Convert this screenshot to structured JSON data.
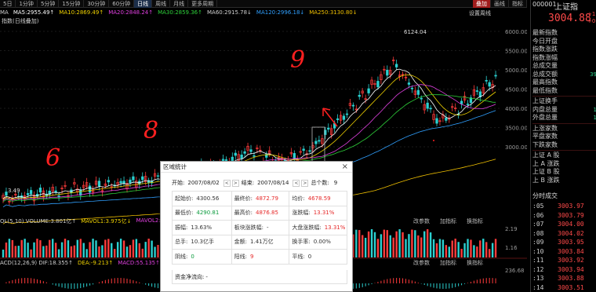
{
  "tabs": [
    "5日",
    "1分钟",
    "5分钟",
    "15分钟",
    "30分钟",
    "60分钟",
    "日线",
    "周线",
    "月线",
    "更多周期"
  ],
  "tabs_right": [
    "叠加",
    "画线",
    "指标"
  ],
  "chart_title": "指数(日线叠加)",
  "settings_label": "设置周线",
  "ma": [
    {
      "label": "MA",
      "color": "#cfcfcf"
    },
    {
      "label": "MA5:2955.49↑",
      "color": "#ffffff"
    },
    {
      "label": "MA10:2869.49↑",
      "color": "#f0d200"
    },
    {
      "label": "MA20:2848.24↑",
      "color": "#e040e0"
    },
    {
      "label": "MA30:2859.36↑",
      "color": "#2ed13a"
    },
    {
      "label": "MA60:2915.78↓",
      "color": "#cfcfcf"
    },
    {
      "label": "MA120:2996.18↓",
      "color": "#30a0ff"
    },
    {
      "label": "MA250:3130.80↓",
      "color": "#f0c000"
    }
  ],
  "yaxis": [
    "6000.00",
    "5500.00",
    "5000.00",
    "4500.00",
    "4000.00",
    "3500.00",
    "3000.00"
  ],
  "peak_label": "6124.04",
  "low_label": "3.49",
  "vol_row": [
    {
      "label": "OL(5,10) VOLUME:3.801亿↑",
      "color": "#cfcfcf"
    },
    {
      "label": "MAVOL1:3.975亿↓",
      "color": "#f0d200"
    },
    {
      "label": "MAVOL2:4.4",
      "color": "#e040e0"
    }
  ],
  "vol_actions": [
    "改参数",
    "加指标",
    "换指标"
  ],
  "vol_axis": [
    "2.19",
    "1.16"
  ],
  "macd_row": [
    {
      "label": "ACD(12,26,9) DIF:18.355↑",
      "color": "#cfcfcf"
    },
    {
      "label": "DEA:-9.213↑",
      "color": "#f0d200"
    },
    {
      "label": "MACD:55.135↑",
      "color": "#e040e0"
    }
  ],
  "macd_actions": [
    "改参数",
    "加指标",
    "换指标"
  ],
  "macd_axis": [
    "236.68"
  ],
  "right_panel": {
    "code": "000001",
    "name": "上证指",
    "price": "3004.88",
    "change_top": "+1",
    "change_bottom": "+0",
    "items": [
      {
        "label": "最新指数",
        "value": ""
      },
      {
        "label": "今日开盘",
        "value": ""
      },
      {
        "label": "指数涨跌",
        "value": ""
      },
      {
        "label": "指数涨幅",
        "value": ""
      },
      {
        "label": "总成交量",
        "value": ""
      },
      {
        "label": "总成交额",
        "value": "39"
      },
      {
        "label": "最高指数",
        "value": ""
      },
      {
        "label": "最低指数",
        "value": ""
      },
      {
        "label": "上证换手",
        "value": ""
      },
      {
        "label": "内盘总量",
        "value": "1"
      },
      {
        "label": "外盘总量",
        "value": "1"
      },
      {
        "label": "上涨家数",
        "value": ""
      },
      {
        "label": "平盘家数",
        "value": ""
      },
      {
        "label": "下跌家数",
        "value": ""
      },
      {
        "label": "上证 A 股",
        "value": ""
      },
      {
        "label": "上 A 涨跌",
        "value": ""
      },
      {
        "label": "上证 B 股",
        "value": ""
      },
      {
        "label": "上 B 涨跌",
        "value": ""
      }
    ],
    "fenshi_label": "分时成交",
    "ticks": [
      {
        "time": ":05",
        "price": "3003.97"
      },
      {
        "time": ":06",
        "price": "3003.79"
      },
      {
        "time": ":07",
        "price": "3004.00"
      },
      {
        "time": ":08",
        "price": "3004.02"
      },
      {
        "time": ":09",
        "price": "3003.95"
      },
      {
        "time": ":10",
        "price": "3003.84"
      },
      {
        "time": ":11",
        "price": "3003.92"
      },
      {
        "time": ":12",
        "price": "3003.94"
      },
      {
        "time": ":13",
        "price": "3003.88"
      },
      {
        "time": ":14",
        "price": "3003.51"
      }
    ]
  },
  "dialog": {
    "title": "区域统计",
    "close": "×",
    "start_label": "开始:",
    "start_value": "2007/08/02",
    "end_label": "结束:",
    "end_value": "2007/08/14",
    "count_label": "总个数:",
    "count_value": "9",
    "rows": [
      [
        {
          "label": "起始价:",
          "value": "4300.56",
          "cls": "dark"
        },
        {
          "label": "最终价:",
          "value": "4872.79",
          "cls": "red"
        },
        {
          "label": "均价:",
          "value": "4678.59",
          "cls": "red"
        }
      ],
      [
        {
          "label": "最低价:",
          "value": "4290.81",
          "cls": "green"
        },
        {
          "label": "最高价:",
          "value": "4876.85",
          "cls": "red"
        },
        {
          "label": "涨跌幅:",
          "value": "13.31%",
          "cls": "red"
        }
      ],
      [
        {
          "label": "振幅:",
          "value": "13.63%",
          "cls": "dark"
        },
        {
          "label": "板块涨跌幅:",
          "value": "-",
          "cls": "dark"
        },
        {
          "label": "大盘涨跌幅:",
          "value": "13.31%",
          "cls": "red"
        }
      ],
      [
        {
          "label": "总手:",
          "value": "10.3亿手",
          "cls": "dark"
        },
        {
          "label": "金额:",
          "value": "1.41万亿",
          "cls": "dark"
        },
        {
          "label": "换手率:",
          "value": "0.00%",
          "cls": "dark"
        }
      ],
      [
        {
          "label": "阴线:",
          "value": "0",
          "cls": "green"
        },
        {
          "label": "阳线:",
          "value": "9",
          "cls": "red"
        },
        {
          "label": "平线:",
          "value": "0",
          "cls": "dark"
        }
      ]
    ],
    "net_flow_label": "资金净流向:",
    "net_flow_value": "-"
  },
  "annotations": [
    "6",
    "8",
    "9"
  ]
}
